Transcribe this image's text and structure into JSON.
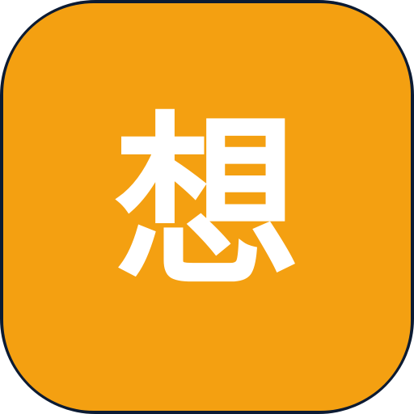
{
  "app_icon": {
    "glyph": "想",
    "colors": {
      "background": "#f4a011",
      "border": "#0c1b33",
      "glyph": "#ffffff"
    }
  }
}
